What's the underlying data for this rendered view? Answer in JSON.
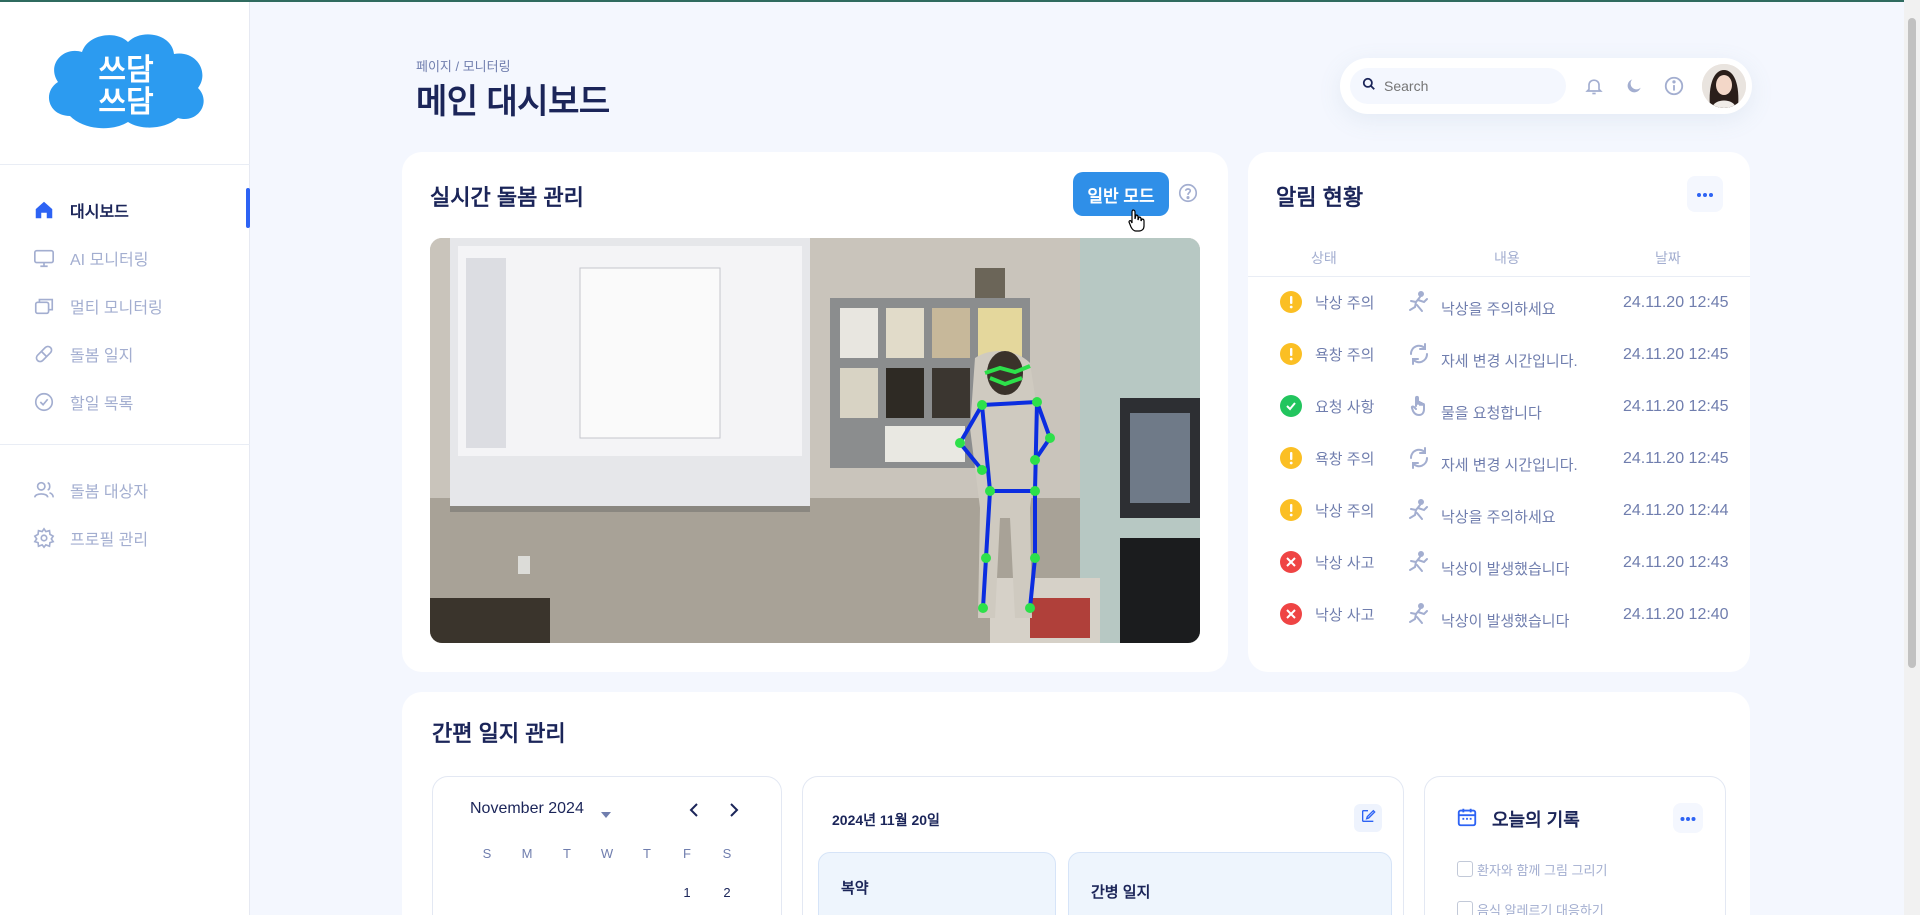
{
  "sidebar": {
    "logo_text": "쓰담쓰담",
    "items": [
      {
        "label": "대시보드",
        "icon": "home-icon",
        "active": true
      },
      {
        "label": "AI 모니터링",
        "icon": "monitor-icon",
        "active": false
      },
      {
        "label": "멀티 모니터링",
        "icon": "multi-window-icon",
        "active": false
      },
      {
        "label": "돌봄 일지",
        "icon": "pill-icon",
        "active": false
      },
      {
        "label": "할일 목록",
        "icon": "check-circle-icon",
        "active": false
      },
      {
        "label": "돌봄 대상자",
        "icon": "users-icon",
        "active": false
      },
      {
        "label": "프로필 관리",
        "icon": "gear-icon",
        "active": false
      }
    ]
  },
  "header": {
    "breadcrumb": "페이지 / 모니터링",
    "title": "메인 대시보드",
    "search_placeholder": "Search"
  },
  "realtime": {
    "title": "실시간 돌봄 관리",
    "mode_button": "일반 모드"
  },
  "alerts": {
    "title": "알림 현황",
    "columns": [
      "상태",
      "내용",
      "날짜"
    ],
    "rows": [
      {
        "status": "낙상 주의",
        "level": "warning",
        "icon": "fall-icon",
        "content": "낙상을 주의하세요",
        "date": "24.11.20 12:45"
      },
      {
        "status": "욕창 주의",
        "level": "warning",
        "icon": "rotate-icon",
        "content": "자세 변경 시간입니다.",
        "date": "24.11.20 12:45"
      },
      {
        "status": "요청 사항",
        "level": "success",
        "icon": "hand-icon",
        "content": "물을 요청합니다",
        "date": "24.11.20 12:45"
      },
      {
        "status": "욕창 주의",
        "level": "warning",
        "icon": "rotate-icon",
        "content": "자세 변경 시간입니다.",
        "date": "24.11.20 12:45"
      },
      {
        "status": "낙상 주의",
        "level": "warning",
        "icon": "fall-icon",
        "content": "낙상을 주의하세요",
        "date": "24.11.20 12:44"
      },
      {
        "status": "낙상 사고",
        "level": "error",
        "icon": "fall-icon",
        "content": "낙상이 발생했습니다",
        "date": "24.11.20 12:43"
      },
      {
        "status": "낙상 사고",
        "level": "error",
        "icon": "fall-icon",
        "content": "낙상이 발생했습니다",
        "date": "24.11.20 12:40"
      }
    ]
  },
  "journal": {
    "title": "간편 일지 관리",
    "calendar": {
      "month": "November 2024",
      "weekdays": [
        "S",
        "M",
        "T",
        "W",
        "T",
        "F",
        "S"
      ],
      "first_week": [
        "",
        "",
        "",
        "",
        "",
        "1",
        "2"
      ]
    },
    "date_label": "2024년 11월 20일",
    "medication_label": "복약",
    "care_log_label": "간병 일지",
    "today": {
      "title": "오늘의 기록",
      "todos": [
        "환자와 함께 그림 그리기",
        "음식 알레르기 대응하기"
      ]
    }
  },
  "colors": {
    "primary": "#2f8fe8",
    "navy": "#1b2559",
    "warning": "#fbbf24",
    "success": "#22c55e",
    "error": "#ef4444",
    "background": "#f4f7fe"
  }
}
